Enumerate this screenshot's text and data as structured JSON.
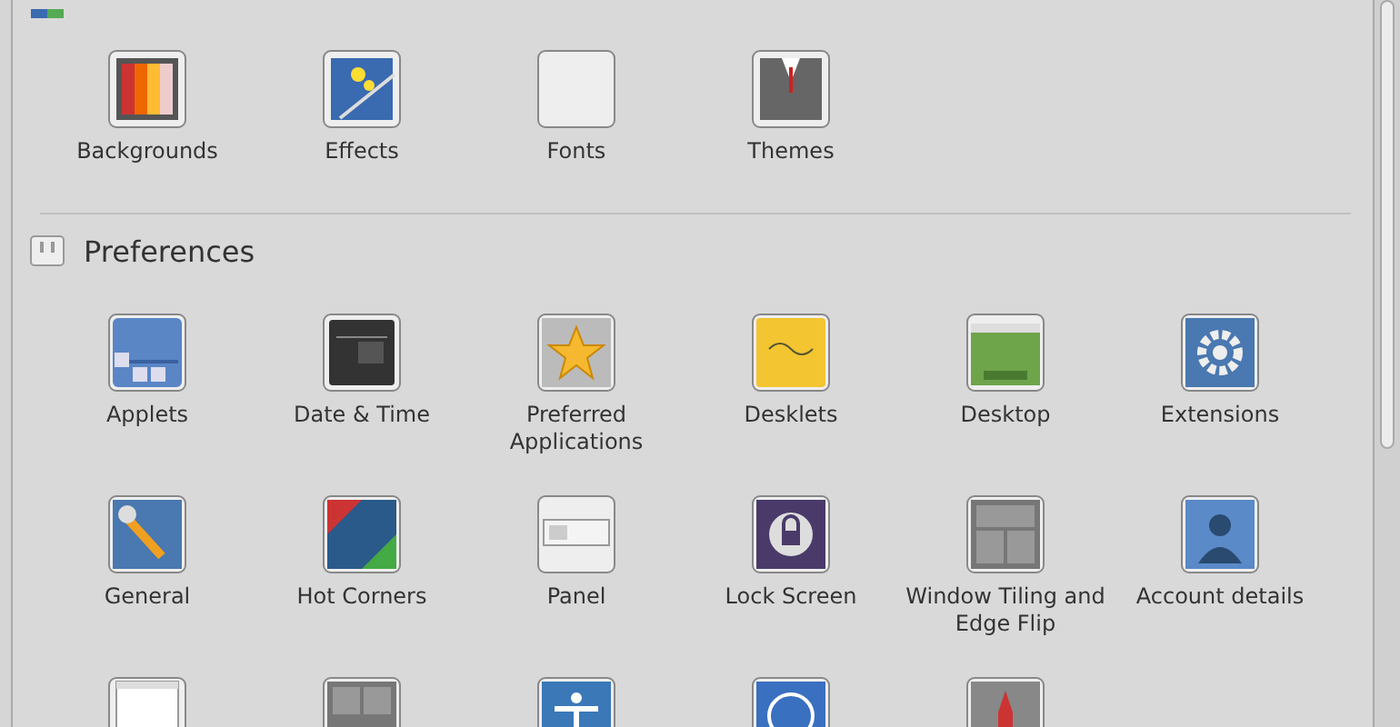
{
  "sections": [
    {
      "items": [
        {
          "label": "Backgrounds"
        },
        {
          "label": "Effects"
        },
        {
          "label": "Fonts"
        },
        {
          "label": "Themes"
        }
      ]
    },
    {
      "title": "Preferences",
      "items": [
        {
          "label": "Applets"
        },
        {
          "label": "Date & Time"
        },
        {
          "label": "Preferred Applications"
        },
        {
          "label": "Desklets"
        },
        {
          "label": "Desktop"
        },
        {
          "label": "Extensions"
        },
        {
          "label": "General"
        },
        {
          "label": "Hot Corners"
        },
        {
          "label": "Panel"
        },
        {
          "label": "Lock Screen"
        },
        {
          "label": "Window Tiling and Edge Flip"
        },
        {
          "label": "Account details"
        }
      ]
    }
  ]
}
